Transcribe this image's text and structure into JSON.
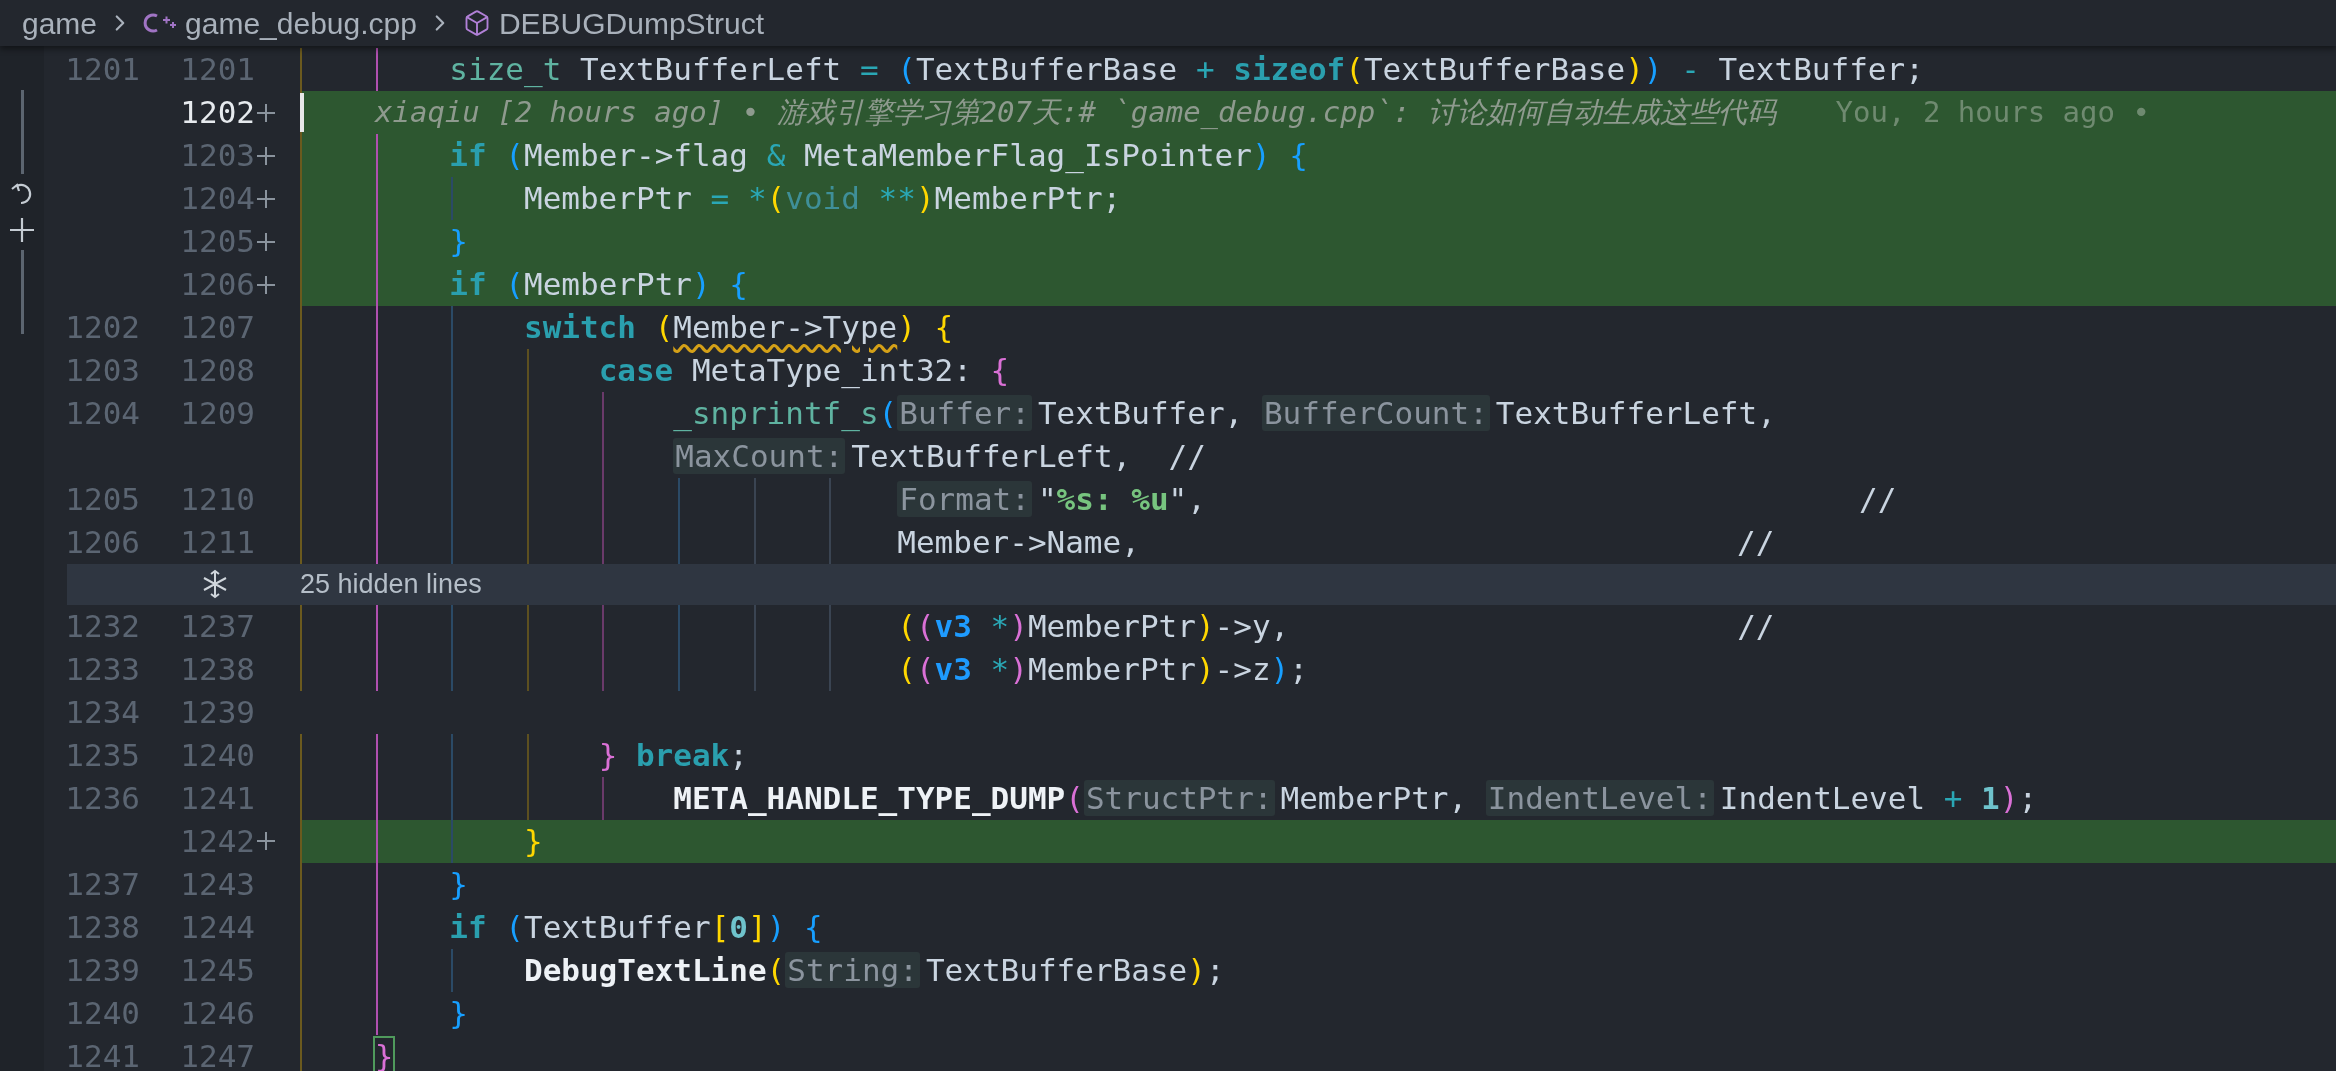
{
  "breadcrumb": [
    {
      "label": "game",
      "kind": "folder"
    },
    {
      "label": "game_debug.cpp",
      "kind": "file"
    },
    {
      "label": "DEBUGDumpStruct",
      "kind": "symbol"
    }
  ],
  "lines": [
    {
      "kind": "code",
      "old": "1201",
      "new": "1201",
      "added": false,
      "current": false,
      "tokens": [
        {
          "text": "        size_t",
          "kind": "type"
        },
        {
          "text": " TextBufferLeft ",
          "kind": "id"
        },
        {
          "text": "= ",
          "kind": "op"
        },
        {
          "text": "(",
          "kind": "b3"
        },
        {
          "text": "TextBufferBase ",
          "kind": "id"
        },
        {
          "text": "+ ",
          "kind": "op"
        },
        {
          "text": "sizeof",
          "kind": "kw"
        },
        {
          "text": "(",
          "kind": "b1"
        },
        {
          "text": "TextBufferBase",
          "kind": "id"
        },
        {
          "text": ")",
          "kind": "b1"
        },
        {
          "text": ") ",
          "kind": "b3"
        },
        {
          "text": "- ",
          "kind": "op"
        },
        {
          "text": "TextBuffer;",
          "kind": "id"
        }
      ]
    },
    {
      "kind": "blame",
      "new": "1202",
      "added": true,
      "current": true,
      "text": "xiaqiu [2 hours ago] • 游戏引擎学习第207天:# `game_debug.cpp`: 讨论如何自动生成这些代码",
      "author": "You, 2 hours ago •"
    },
    {
      "kind": "code",
      "new": "1203",
      "added": true,
      "current": false,
      "tokens": [
        {
          "text": "        if ",
          "kind": "kw"
        },
        {
          "text": "(",
          "kind": "b3"
        },
        {
          "text": "Member->flag ",
          "kind": "id"
        },
        {
          "text": "& ",
          "kind": "op"
        },
        {
          "text": "MetaMemberFlag_IsPointer",
          "kind": "id"
        },
        {
          "text": ") ",
          "kind": "b3"
        },
        {
          "text": "{",
          "kind": "b3"
        }
      ]
    },
    {
      "kind": "code",
      "new": "1204",
      "added": true,
      "current": false,
      "tokens": [
        {
          "text": "            MemberPtr ",
          "kind": "id"
        },
        {
          "text": "= ",
          "kind": "op"
        },
        {
          "text": "*",
          "kind": "op"
        },
        {
          "text": "(",
          "kind": "b1"
        },
        {
          "text": "void ",
          "kind": "dim"
        },
        {
          "text": "**",
          "kind": "op"
        },
        {
          "text": ")",
          "kind": "b1"
        },
        {
          "text": "MemberPtr;",
          "kind": "id"
        }
      ]
    },
    {
      "kind": "code",
      "new": "1205",
      "added": true,
      "current": false,
      "tokens": [
        {
          "text": "        }",
          "kind": "b3"
        }
      ]
    },
    {
      "kind": "code",
      "new": "1206",
      "added": true,
      "current": false,
      "tokens": [
        {
          "text": "        if ",
          "kind": "kw"
        },
        {
          "text": "(",
          "kind": "b3"
        },
        {
          "text": "MemberPtr",
          "kind": "id"
        },
        {
          "text": ") ",
          "kind": "b3"
        },
        {
          "text": "{",
          "kind": "b3"
        }
      ]
    },
    {
      "kind": "code",
      "old": "1202",
      "new": "1207",
      "added": false,
      "current": false,
      "tokens": [
        {
          "text": "            switch ",
          "kind": "kw"
        },
        {
          "text": "(",
          "kind": "b1"
        },
        {
          "text": "Member->Type",
          "kind": "warn"
        },
        {
          "text": ") ",
          "kind": "b1"
        },
        {
          "text": "{",
          "kind": "b1"
        }
      ]
    },
    {
      "kind": "code",
      "old": "1203",
      "new": "1208",
      "added": false,
      "current": false,
      "tokens": [
        {
          "text": "                case",
          "kind": "kw"
        },
        {
          "text": " MetaType_int32: ",
          "kind": "id"
        },
        {
          "text": "{",
          "kind": "b2"
        }
      ]
    },
    {
      "kind": "code",
      "old": "1204",
      "new": "1209",
      "added": false,
      "current": false,
      "tokens": [
        {
          "text": "                    _snprintf_s",
          "kind": "fn"
        },
        {
          "text": "(",
          "kind": "b3"
        },
        {
          "text": "Buffer:",
          "kind": "hint"
        },
        {
          "text": "TextBuffer, ",
          "kind": "id"
        },
        {
          "text": "BufferCount:",
          "kind": "hint"
        },
        {
          "text": "TextBufferLeft,",
          "kind": "id"
        }
      ]
    },
    {
      "kind": "code",
      "added": false,
      "current": false,
      "tokens": [
        {
          "text": "                    MaxCount:",
          "kind": "hint"
        },
        {
          "text": "TextBufferLeft,  //",
          "kind": "id"
        }
      ]
    },
    {
      "kind": "code",
      "old": "1205",
      "new": "1210",
      "added": false,
      "current": false,
      "tokens": [
        {
          "text": "                                Format:",
          "kind": "hint"
        },
        {
          "text": "\"",
          "kind": "id"
        },
        {
          "text": "%s: %u",
          "kind": "str"
        },
        {
          "text": "\",                                   //",
          "kind": "id"
        }
      ]
    },
    {
      "kind": "code",
      "old": "1206",
      "new": "1211",
      "added": false,
      "current": false,
      "tokens": [
        {
          "text": "                                Member->Name,                                //",
          "kind": "id"
        }
      ]
    },
    {
      "kind": "fold",
      "label": "25 hidden lines"
    },
    {
      "kind": "code",
      "old": "1232",
      "new": "1237",
      "added": false,
      "current": false,
      "tokens": [
        {
          "text": "                                (",
          "kind": "b1"
        },
        {
          "text": "(",
          "kind": "b2"
        },
        {
          "text": "v3 ",
          "kind": "t3"
        },
        {
          "text": "*",
          "kind": "op"
        },
        {
          "text": ")",
          "kind": "b2"
        },
        {
          "text": "MemberPtr",
          "kind": "id"
        },
        {
          "text": ")",
          "kind": "b1"
        },
        {
          "text": "->y,                        //",
          "kind": "id"
        }
      ]
    },
    {
      "kind": "code",
      "old": "1233",
      "new": "1238",
      "added": false,
      "current": false,
      "tokens": [
        {
          "text": "                                (",
          "kind": "b1"
        },
        {
          "text": "(",
          "kind": "b2"
        },
        {
          "text": "v3 ",
          "kind": "t3"
        },
        {
          "text": "*",
          "kind": "op"
        },
        {
          "text": ")",
          "kind": "b2"
        },
        {
          "text": "MemberPtr",
          "kind": "id"
        },
        {
          "text": ")",
          "kind": "b1"
        },
        {
          "text": "->z",
          "kind": "id"
        },
        {
          "text": ")",
          "kind": "b3"
        },
        {
          "text": ";",
          "kind": "id"
        }
      ]
    },
    {
      "kind": "code",
      "old": "1234",
      "new": "1239",
      "added": false,
      "current": false
    },
    {
      "kind": "code",
      "old": "1235",
      "new": "1240",
      "added": false,
      "current": false,
      "tokens": [
        {
          "text": "                } ",
          "kind": "b2"
        },
        {
          "text": "break",
          "kind": "kw"
        },
        {
          "text": ";",
          "kind": "id"
        }
      ]
    },
    {
      "kind": "code",
      "old": "1236",
      "new": "1241",
      "added": false,
      "current": false,
      "tokens": [
        {
          "text": "                    META_HANDLE_TYPE_DUMP",
          "kind": "macro"
        },
        {
          "text": "(",
          "kind": "b2"
        },
        {
          "text": "StructPtr:",
          "kind": "hint"
        },
        {
          "text": "MemberPtr, ",
          "kind": "id"
        },
        {
          "text": "IndentLevel:",
          "kind": "hint"
        },
        {
          "text": "IndentLevel ",
          "kind": "id"
        },
        {
          "text": "+ ",
          "kind": "op"
        },
        {
          "text": "1",
          "kind": "num"
        },
        {
          "text": ")",
          "kind": "b2"
        },
        {
          "text": ";",
          "kind": "id"
        }
      ]
    },
    {
      "kind": "code",
      "new": "1242",
      "added": true,
      "current": false,
      "tokens": [
        {
          "text": "            }",
          "kind": "b1"
        }
      ]
    },
    {
      "kind": "code",
      "old": "1237",
      "new": "1243",
      "added": false,
      "current": false,
      "tokens": [
        {
          "text": "        }",
          "kind": "b3"
        }
      ]
    },
    {
      "kind": "code",
      "old": "1238",
      "new": "1244",
      "added": false,
      "current": false,
      "tokens": [
        {
          "text": "        if ",
          "kind": "kw"
        },
        {
          "text": "(",
          "kind": "b3"
        },
        {
          "text": "TextBuffer",
          "kind": "id"
        },
        {
          "text": "[",
          "kind": "b1"
        },
        {
          "text": "0",
          "kind": "num"
        },
        {
          "text": "]",
          "kind": "b1"
        },
        {
          "text": ") ",
          "kind": "b3"
        },
        {
          "text": "{",
          "kind": "b3"
        }
      ]
    },
    {
      "kind": "code",
      "old": "1239",
      "new": "1245",
      "added": false,
      "current": false,
      "tokens": [
        {
          "text": "            DebugTextLine",
          "kind": "macro"
        },
        {
          "text": "(",
          "kind": "b1"
        },
        {
          "text": "String:",
          "kind": "hint"
        },
        {
          "text": "TextBufferBase",
          "kind": "id"
        },
        {
          "text": ")",
          "kind": "b1"
        },
        {
          "text": ";",
          "kind": "id"
        }
      ]
    },
    {
      "kind": "code",
      "old": "1240",
      "new": "1246",
      "added": false,
      "current": false,
      "tokens": [
        {
          "text": "        }",
          "kind": "b3"
        }
      ]
    },
    {
      "kind": "code",
      "old": "1241",
      "new": "1247",
      "added": false,
      "current": false,
      "tokens": [
        {
          "text": "    }",
          "kind": "match"
        }
      ]
    }
  ]
}
